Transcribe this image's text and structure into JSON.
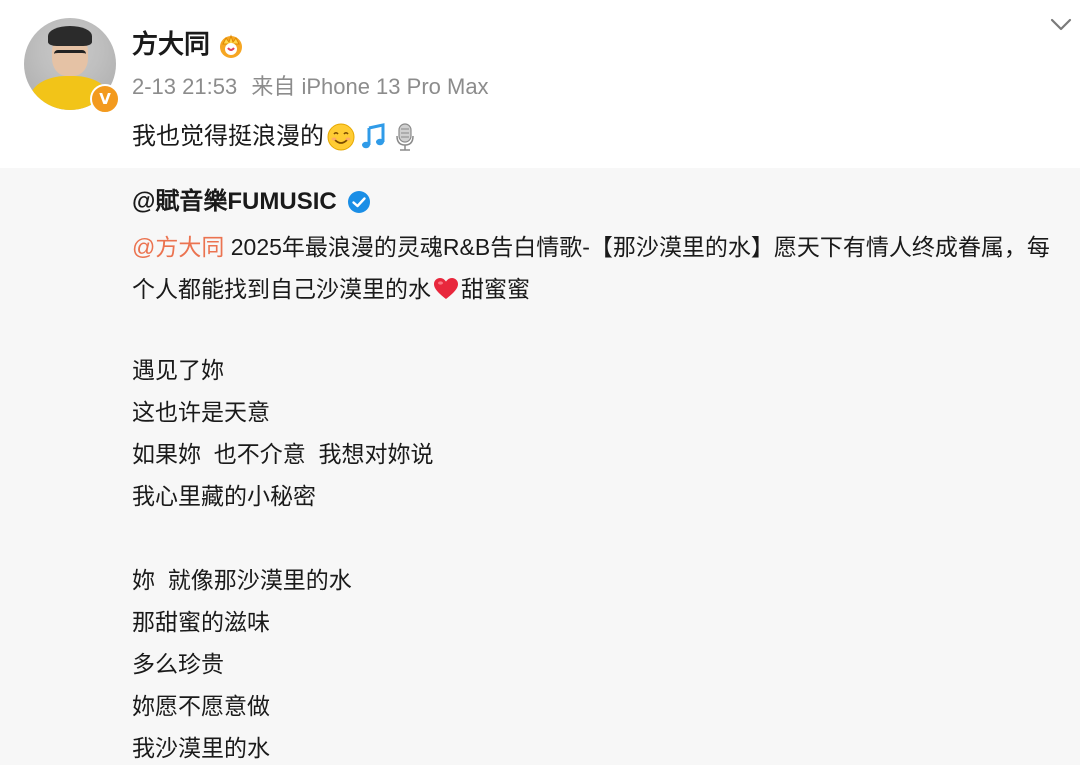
{
  "post": {
    "author": "方大同",
    "time": "2-13 21:53",
    "source": "来自 iPhone 13 Pro Max",
    "text": "我也觉得挺浪漫的",
    "emojis": [
      "smiling-face-emoji",
      "music-notes-emoji",
      "microphone-emoji"
    ],
    "author_badge_icon": "crown-icon",
    "verified_icon": "orange-verified-v-icon",
    "verified_badge_text": "V",
    "menu_icon": "chevron-down-icon"
  },
  "repost": {
    "author": "@賦音樂FUMUSIC",
    "verified_icon": "blue-verified-icon",
    "mention": "@方大同",
    "text_before_heart": " 2025年最浪漫的灵魂R&B告白情歌-【那沙漠里的水】愿天下有情人终成眷属，每个人都能找到自己沙漠里的水",
    "heart_icon": "red-heart-icon",
    "text_after_heart": "甜蜜蜜",
    "lyrics_stanza_1": [
      "遇见了妳",
      "这也许是天意",
      "如果妳  也不介意  我想对妳说",
      "我心里藏的小秘密"
    ],
    "lyrics_stanza_2": [
      "妳  就像那沙漠里的水",
      "那甜蜜的滋味",
      "多么珍贵",
      "妳愿不愿意做",
      "我沙漠里的水"
    ]
  },
  "colors": {
    "mention": "#eb7350",
    "repost_bg": "#f7f7f7",
    "meta_text": "#8c8c8c",
    "verified_orange": "#f39a1e",
    "verified_blue": "#1a8ee6"
  }
}
